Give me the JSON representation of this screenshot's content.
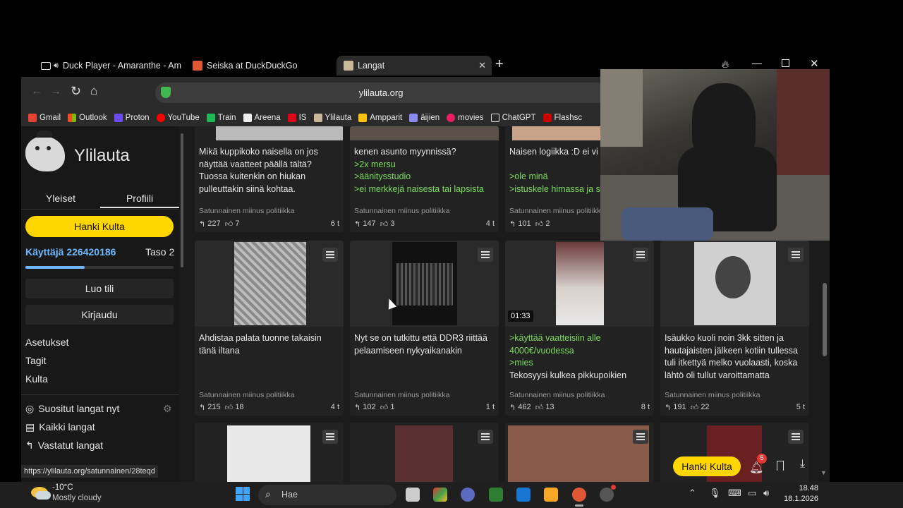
{
  "tabs": [
    {
      "title": "Duck Player - Amaranthe - Am"
    },
    {
      "title": "Seiska at DuckDuckGo"
    },
    {
      "title": "Langat"
    }
  ],
  "address": {
    "url": "ylilauta.org"
  },
  "bookmarks": [
    "Gmail",
    "Outlook",
    "Proton",
    "YouTube",
    "Train",
    "Areena",
    "IS",
    "Ylilauta",
    "Ampparit",
    "äijien",
    "movies",
    "ChatGPT",
    "Flashsc"
  ],
  "sidebar": {
    "site_name": "Ylilauta",
    "tabs": [
      "Yleiset",
      "Profiili"
    ],
    "gold_button": "Hanki Kulta",
    "user": "Käyttäjä 226420186",
    "level": "Taso 2",
    "create_account": "Luo tili",
    "login": "Kirjaudu",
    "links": [
      "Asetukset",
      "Tagit",
      "Kulta"
    ],
    "threads": [
      "Suositut langat nyt",
      "Kaikki langat",
      "Vastatut langat"
    ]
  },
  "cards_top": [
    {
      "lines": [
        "Mikä kuppikoko naisella on jos näyttää vaatteet päällä tältä? Tuossa kuitenkin on hiukan pulleuttakin siinä kohtaa."
      ],
      "greens": [],
      "category": "Satunnainen miinus politiikka",
      "replies": "227",
      "likes": "7",
      "time": "6 t"
    },
    {
      "lines": [
        "kenen asunto myynnissä?"
      ],
      "greens": [
        ">2x mersu",
        ">äänitysstudio",
        ">ei merkkejä naisesta tai lapsista"
      ],
      "category": "Satunnainen miinus politiikka",
      "replies": "147",
      "likes": "3",
      "time": "4 t"
    },
    {
      "lines": [
        "Naisen logiikka :D ei vi"
      ],
      "greens": [
        ">ole minä",
        ">istuskele himassa ja s"
      ],
      "category": "Satunnainen miinus politiikka",
      "replies": "101",
      "likes": "2",
      "time": ""
    }
  ],
  "cards_mid": [
    {
      "text": "Ahdistaa palata tuonne takaisin tänä iltana",
      "green": [],
      "after": "",
      "category": "Satunnainen miinus politiikka",
      "replies": "215",
      "likes": "18",
      "time": "4 t",
      "duration": ""
    },
    {
      "text": "Nyt se on tutkittu että DDR3 riittää pelaamiseen nykyaikanakin",
      "green": [],
      "after": "",
      "category": "Satunnainen miinus politiikka",
      "replies": "102",
      "likes": "1",
      "time": "1 t",
      "duration": ""
    },
    {
      "text": "",
      "green": [
        ">käyttää vaatteisiin alle 4000€/vuodessa",
        ">mies"
      ],
      "after": "Tekosyysi kulkea pikkupoikien",
      "category": "Satunnainen miinus politiikka",
      "replies": "462",
      "likes": "13",
      "time": "8 t",
      "duration": "01:33"
    },
    {
      "text": "Isäukko kuoli noin 3kk sitten ja hautajaisten jälkeen kotiin tullessa tuli itkettyä melko vuolaasti, koska lähtö oli tullut varoittamatta",
      "green": [],
      "after": "",
      "category": "Satunnainen miinus politiikka",
      "replies": "191",
      "likes": "22",
      "time": "5 t",
      "duration": ""
    }
  ],
  "footer": {
    "status_url": "https://ylilauta.org/satunnainen/28teqd",
    "gold_button": "Hanki Kulta",
    "notif_count": "5"
  },
  "taskbar": {
    "weather_temp": "-10°C",
    "weather_desc": "Mostly cloudy",
    "search_placeholder": "Hae",
    "time": "18.48",
    "date": "18.1.2026"
  },
  "colors": {
    "accent_yellow": "#ffd600",
    "green_text": "#7ddc5e",
    "link_blue": "#6fb8ff"
  }
}
